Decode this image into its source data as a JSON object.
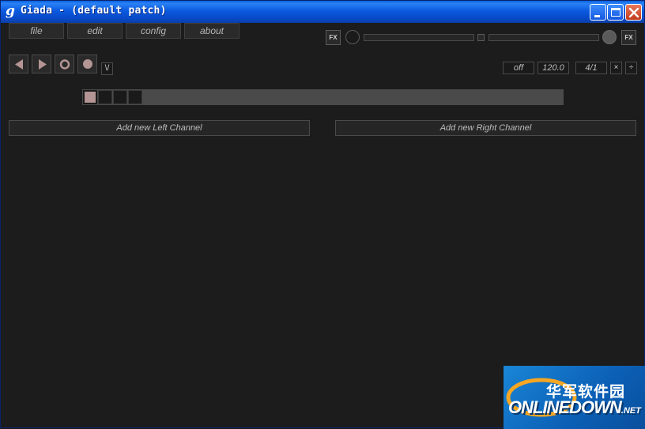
{
  "window": {
    "title": "Giada - (default patch)",
    "app_icon_glyph": "g",
    "controls": [
      "minimize-icon",
      "maximize-icon",
      "close-icon"
    ]
  },
  "menu": {
    "items": [
      {
        "label": "file"
      },
      {
        "label": "edit"
      },
      {
        "label": "config"
      },
      {
        "label": "about"
      }
    ]
  },
  "master": {
    "fx_in_label": "FX",
    "fx_out_label": "FX"
  },
  "transport": {
    "buttons": [
      "rewind-icon",
      "play-icon",
      "record-actions-icon",
      "record-input-icon"
    ],
    "metronome_label": "\\/"
  },
  "timing": {
    "quantize": "off",
    "bpm": "120.0",
    "beats": "4/1",
    "multiply_label": "×",
    "divide_label": "÷"
  },
  "sequencer": {
    "beats": 4,
    "active_beat": 1
  },
  "columns": {
    "left_add_label": "Add new Left Channel",
    "right_add_label": "Add new Right Channel"
  },
  "watermark": {
    "cn_text": "华军软件园",
    "en_text": "ONLINEDOWN",
    "net_text": ".NET"
  },
  "colors": {
    "background": "#1c1c1c",
    "titlebar": "#0b5ae0",
    "active_beat": "#b49494",
    "record_dot": "#b49494"
  }
}
